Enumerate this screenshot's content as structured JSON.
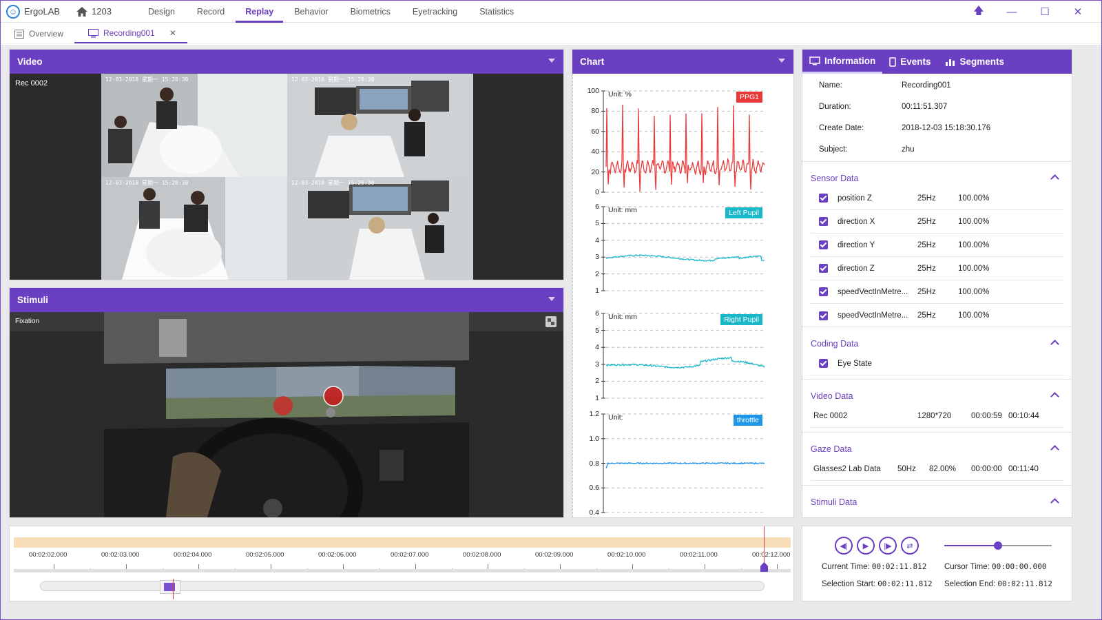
{
  "app": {
    "name": "ErgoLAB",
    "project": "1203"
  },
  "nav": [
    {
      "label": "Design"
    },
    {
      "label": "Record"
    },
    {
      "label": "Replay",
      "active": true
    },
    {
      "label": "Behavior"
    },
    {
      "label": "Biometrics"
    },
    {
      "label": "Eyetracking"
    },
    {
      "label": "Statistics"
    }
  ],
  "tabs": [
    {
      "label": "Overview"
    },
    {
      "label": "Recording001",
      "active": true
    }
  ],
  "video": {
    "title": "Video",
    "label": "Rec 0002",
    "timestamps": [
      "12-03-2018 星期一 15:20:30",
      "12-03-2018 星期一 15:20:30",
      "12-03-2018 星期一 15:20:30",
      "12-03-2018 星期一 15:20:30"
    ]
  },
  "stimuli": {
    "title": "Stimuli",
    "label": "Fixation"
  },
  "chart": {
    "title": "Chart",
    "subplots": [
      {
        "tag": "PPG1",
        "unit": "Unit: %",
        "color": "#e83a3a",
        "ylim": [
          0,
          100
        ],
        "yticks": [
          "100",
          "80",
          "60",
          "40",
          "20",
          "0"
        ]
      },
      {
        "tag": "Left Pupil",
        "unit": "Unit: mm",
        "color": "#1ab8c8",
        "ylim": [
          1,
          6
        ],
        "yticks": [
          "6",
          "5",
          "4",
          "3",
          "2",
          "1"
        ]
      },
      {
        "tag": "Right Pupil",
        "unit": "Unit: mm",
        "color": "#1ab8c8",
        "ylim": [
          1,
          6
        ],
        "yticks": [
          "6",
          "5",
          "4",
          "3",
          "2",
          "1"
        ]
      },
      {
        "tag": "throttle",
        "unit": "Unit:",
        "color": "#1f96e8",
        "ylim": [
          0.4,
          1.2
        ],
        "yticks": [
          "1.2",
          "1.0",
          "0.8",
          "0.6",
          "0.4"
        ]
      }
    ]
  },
  "info": {
    "tabs": [
      {
        "label": "Information",
        "active": true
      },
      {
        "label": "Events"
      },
      {
        "label": "Segments"
      }
    ],
    "fields": [
      {
        "key": "Name:",
        "value": "Recording001"
      },
      {
        "key": "Duration:",
        "value": "00:11:51.307"
      },
      {
        "key": "Create Date:",
        "value": "2018-12-03 15:18:30.176"
      },
      {
        "key": "Subject:",
        "value": "zhu"
      }
    ],
    "sensor_title": "Sensor Data",
    "sensor_rows": [
      {
        "name": "position Z",
        "rate": "25Hz",
        "pct": "100.00%"
      },
      {
        "name": "direction X",
        "rate": "25Hz",
        "pct": "100.00%"
      },
      {
        "name": "direction Y",
        "rate": "25Hz",
        "pct": "100.00%"
      },
      {
        "name": "direction Z",
        "rate": "25Hz",
        "pct": "100.00%"
      },
      {
        "name": "speedVectInMetre...",
        "rate": "25Hz",
        "pct": "100.00%"
      },
      {
        "name": "speedVectInMetre...",
        "rate": "25Hz",
        "pct": "100.00%"
      }
    ],
    "coding_title": "Coding Data",
    "coding_rows": [
      {
        "name": "Eye State"
      }
    ],
    "video_title": "Video Data",
    "video_rows": [
      {
        "name": "Rec 0002",
        "res": "1280*720",
        "start": "00:00:59",
        "end": "00:10:44"
      }
    ],
    "gaze_title": "Gaze Data",
    "gaze_rows": [
      {
        "name": "Glasses2 Lab Data",
        "rate": "50Hz",
        "pct": "82.00%",
        "start": "00:00:00",
        "end": "00:11:40"
      }
    ],
    "stimuli_title": "Stimuli Data"
  },
  "timeline": {
    "ticks": [
      "00:02:02.000",
      "00:02:03.000",
      "00:02:04.000",
      "00:02:05.000",
      "00:02:06.000",
      "00:02:07.000",
      "00:02:08.000",
      "00:02:09.000",
      "00:02:10.000",
      "00:02:11.000",
      "00:02:12.000"
    ]
  },
  "playback": {
    "current_label": "Current Time:",
    "current": "00:02:11.812",
    "cursor_label": "Cursor Time:",
    "cursor": "00:00:00.000",
    "sel_start_label": "Selection Start:",
    "sel_start": "00:02:11.812",
    "sel_end_label": "Selection End:",
    "sel_end": "00:02:11.812",
    "volume": 0.5
  },
  "colors": {
    "accent": "#6b3fc1",
    "ppg": "#e83a3a",
    "pupil": "#1ab8c8",
    "throttle": "#1f96e8"
  }
}
